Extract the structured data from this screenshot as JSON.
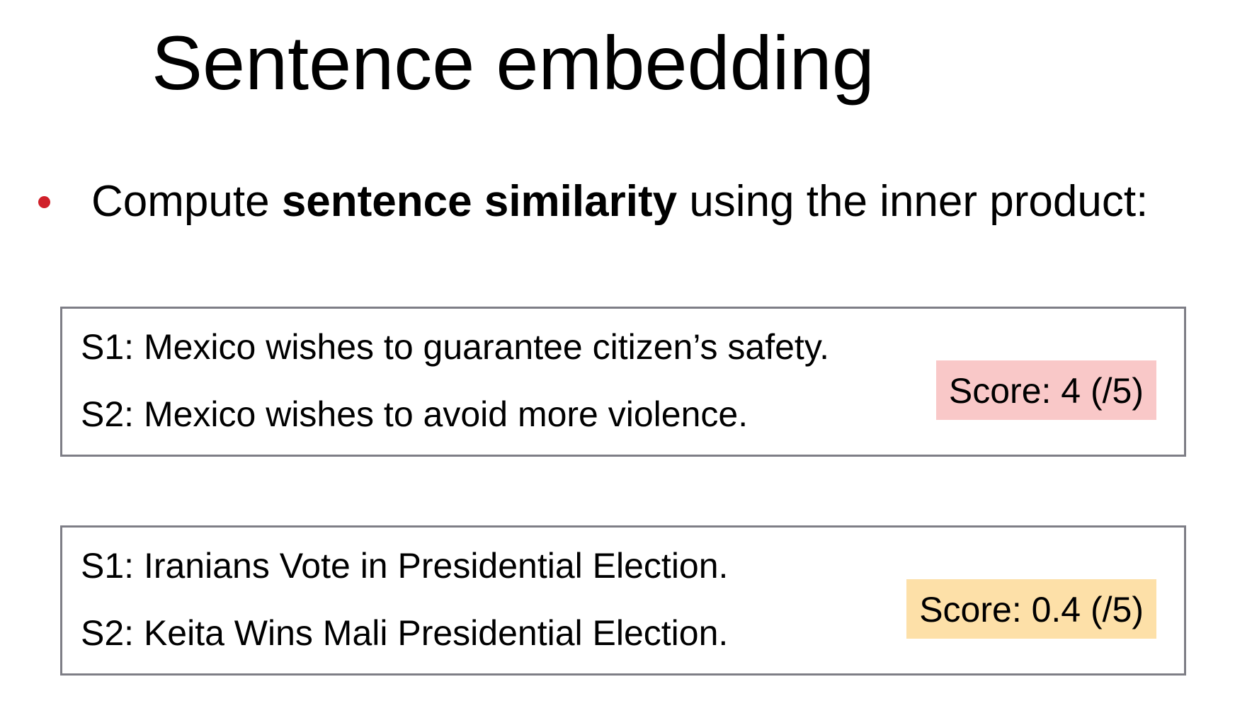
{
  "slide": {
    "title": "Sentence embedding",
    "bullet": {
      "prefix": "Compute ",
      "bold": "sentence similarity",
      "suffix": " using the inner product:"
    },
    "pairs": [
      {
        "s1": "S1: Mexico wishes to guarantee citizen’s safety.",
        "s2": "S2: Mexico wishes to avoid more violence.",
        "score": "Score: 4 (/5)",
        "score_color": "#f9c8c8"
      },
      {
        "s1": "S1: Iranians Vote in Presidential Election.",
        "s2": "S2: Keita Wins Mali Presidential Election.",
        "score": "Score: 0.4 (/5)",
        "score_color": "#fde0a8"
      }
    ],
    "colors": {
      "bullet": "#d0202a",
      "box_border": "#7e7e86"
    }
  }
}
